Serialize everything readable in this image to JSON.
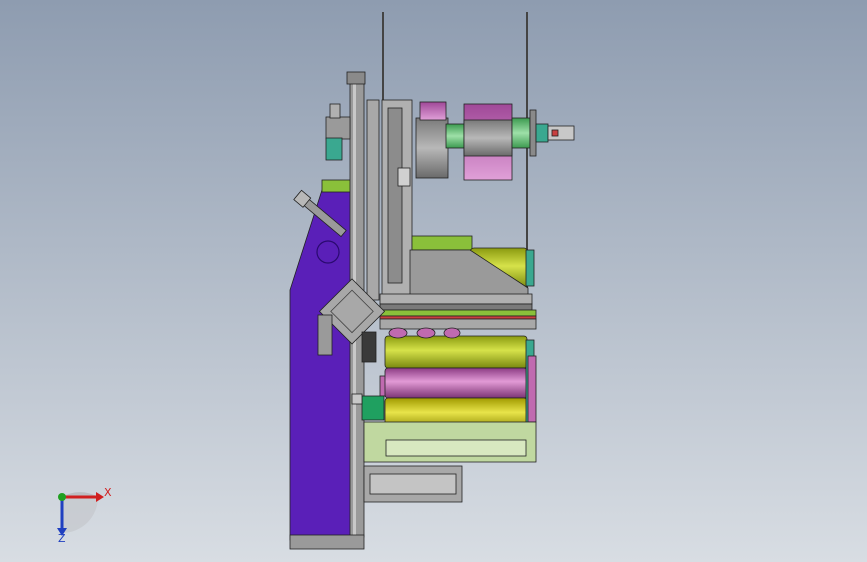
{
  "viewport": {
    "background_top": "#8e9cb0",
    "background_bottom": "#d8dde3"
  },
  "colors": {
    "purple_frame": "#5a1fb8",
    "steel": "#9a9a9a",
    "steel_dark": "#6f6f6f",
    "olive_roller": "#b4c42a",
    "pink_roller": "#c06ab0",
    "yellow_roller": "#c8c41a",
    "blue_roller": "#5050a8",
    "green_shaft": "#6cc47c",
    "teal_part": "#3aa890",
    "base_green": "#c0d8a0"
  },
  "triad": {
    "x_label": "X",
    "z_label": "Z",
    "x_color": "#d02020",
    "y_color": "#20a020",
    "z_color": "#2040c0"
  }
}
